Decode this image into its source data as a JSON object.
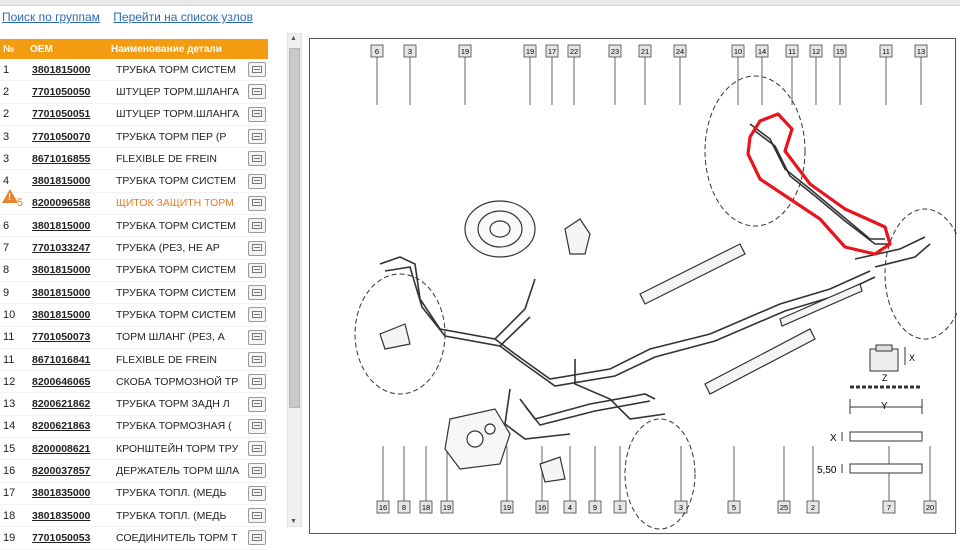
{
  "nav": {
    "search_by_groups": "Поиск по группам",
    "go_to_nodes": "Перейти на список узлов"
  },
  "table": {
    "headers": {
      "num": "№",
      "oem": "OEM",
      "name": "Наименование детали"
    },
    "rows": [
      {
        "num": "1",
        "oem": "3801815000",
        "name": "ТРУБКА ТОРМ СИСТЕМ"
      },
      {
        "num": "2",
        "oem": "7701050050",
        "name": "ШТУЦЕР ТОРМ.ШЛАНГА"
      },
      {
        "num": "2",
        "oem": "7701050051",
        "name": "ШТУЦЕР ТОРМ.ШЛАНГА"
      },
      {
        "num": "3",
        "oem": "7701050070",
        "name": "ТРУБКА ТОРМ ПЕР (Р"
      },
      {
        "num": "3",
        "oem": "8671016855",
        "name": "FLEXIBLE DE FREIN"
      },
      {
        "num": "4",
        "oem": "3801815000",
        "name": "ТРУБКА ТОРМ СИСТЕМ"
      },
      {
        "num": "5",
        "oem": "8200096588",
        "name": "ЩИТОК ЗАЩИТН ТОРМ",
        "warn": true
      },
      {
        "num": "6",
        "oem": "3801815000",
        "name": "ТРУБКА ТОРМ СИСТЕМ"
      },
      {
        "num": "7",
        "oem": "7701033247",
        "name": "ТРУБКА (РЕЗ, НЕ АР"
      },
      {
        "num": "8",
        "oem": "3801815000",
        "name": "ТРУБКА ТОРМ СИСТЕМ"
      },
      {
        "num": "9",
        "oem": "3801815000",
        "name": "ТРУБКА ТОРМ СИСТЕМ"
      },
      {
        "num": "10",
        "oem": "3801815000",
        "name": "ТРУБКА ТОРМ СИСТЕМ"
      },
      {
        "num": "11",
        "oem": "7701050073",
        "name": "ТОРМ ШЛАНГ (РЕЗ, А"
      },
      {
        "num": "11",
        "oem": "8671016841",
        "name": "FLEXIBLE DE FREIN"
      },
      {
        "num": "12",
        "oem": "8200646065",
        "name": "СКОБА ТОРМОЗНОЙ ТР"
      },
      {
        "num": "13",
        "oem": "8200621862",
        "name": "ТРУБКА ТОРМ ЗАДН Л"
      },
      {
        "num": "14",
        "oem": "8200621863",
        "name": "ТРУБКА ТОРМОЗНАЯ ("
      },
      {
        "num": "15",
        "oem": "8200008621",
        "name": "КРОНШТЕЙН ТОРМ ТРУ"
      },
      {
        "num": "16",
        "oem": "8200037857",
        "name": "ДЕРЖАТЕЛЬ ТОРМ ШЛА"
      },
      {
        "num": "17",
        "oem": "3801835000",
        "name": "ТРУБКА ТОПЛ. (МЕДЬ"
      },
      {
        "num": "18",
        "oem": "3801835000",
        "name": "ТРУБКА ТОПЛ. (МЕДЬ"
      },
      {
        "num": "19",
        "oem": "7701050053",
        "name": "СОЕДИНИТЕЛЬ ТОРМ Т"
      }
    ]
  },
  "diagram": {
    "top_callouts": [
      "6",
      "3",
      "19",
      "19",
      "17",
      "22",
      "23",
      "21",
      "24",
      "10",
      "14",
      "11",
      "12",
      "15",
      "11",
      "13"
    ],
    "bottom_callouts": [
      "16",
      "8",
      "18",
      "19",
      "19",
      "16",
      "4",
      "9",
      "1",
      "3",
      "5",
      "25",
      "2",
      "7",
      "20"
    ],
    "detail_labels": {
      "x": "X",
      "y": "Y",
      "z": "Z",
      "dim": "5,50"
    },
    "highlight_color": "#e8141e",
    "warn_color": "#e8832e",
    "accent_color": "#f39c12"
  }
}
